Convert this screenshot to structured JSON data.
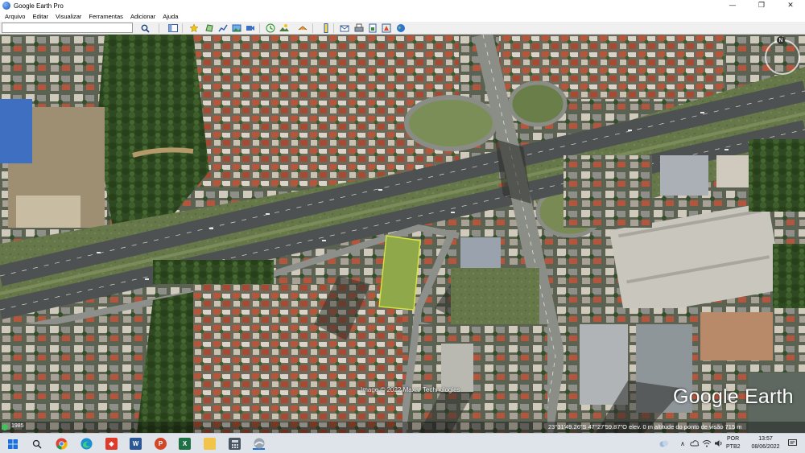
{
  "window": {
    "title": "Google Earth Pro",
    "minimize_glyph": "—",
    "maximize_glyph": "❐",
    "close_glyph": "✕"
  },
  "menu": [
    "Arquivo",
    "Editar",
    "Visualizar",
    "Ferramentas",
    "Adicionar",
    "Ajuda"
  ],
  "search": {
    "value": "",
    "placeholder": ""
  },
  "map": {
    "imagery_copyright": "Image © 2022 Maxar Technologies",
    "brand": "Google Earth",
    "year": "1985",
    "coordinates": "23°31'49.26\"S   47°27'59.87\"O   elev.   0 m   altitude do ponto de visão   715 m",
    "compass_label": "N"
  },
  "taskbar": {
    "language_top": "POR",
    "language_bottom": "PTB2",
    "time": "13:57",
    "date": "08/06/2022",
    "apps": [
      "start-button",
      "search-icon",
      "chrome-icon",
      "edge-icon",
      "anydesk-icon",
      "word-icon",
      "powerpoint-icon",
      "excel-icon",
      "file-explorer-icon",
      "calculator-icon",
      "google-earth-icon"
    ]
  },
  "colors": {
    "taskbar": "#dfe3ea",
    "parcel_outline": "#d9e63a",
    "toolbar": "#f0f0f0"
  }
}
